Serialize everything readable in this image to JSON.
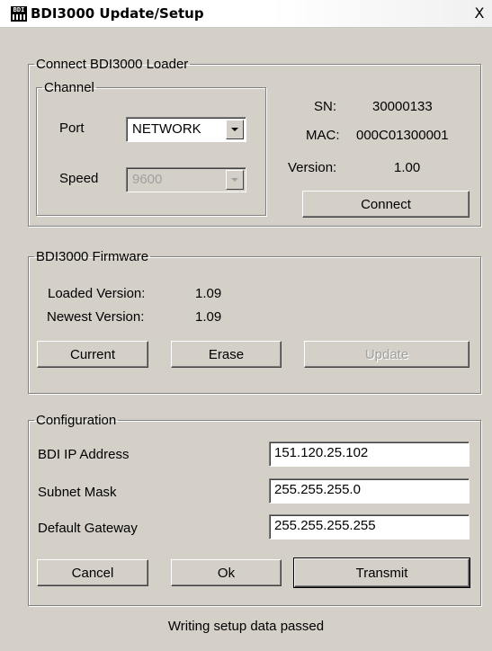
{
  "window": {
    "title": "BDI3000 Update/Setup",
    "icon_text": "BDI",
    "close_glyph": "X"
  },
  "loader": {
    "legend": "Connect BDI3000 Loader",
    "channel_legend": "Channel",
    "port_label": "Port",
    "port_value": "NETWORK",
    "speed_label": "Speed",
    "speed_value": "9600",
    "sn_label": "SN:",
    "sn_value": "30000133",
    "mac_label": "MAC:",
    "mac_value": "000C01300001",
    "version_label": "Version:",
    "version_value": "1.00",
    "connect_label": "Connect"
  },
  "firmware": {
    "legend": "BDI3000 Firmware",
    "loaded_label": "Loaded Version:",
    "loaded_value": "1.09",
    "newest_label": "Newest Version:",
    "newest_value": "1.09",
    "current_label": "Current",
    "erase_label": "Erase",
    "update_label": "Update"
  },
  "config": {
    "legend": "Configuration",
    "ip_label": "BDI IP Address",
    "ip_value": "151.120.25.102",
    "subnet_label": "Subnet Mask",
    "subnet_value": "255.255.255.0",
    "gateway_label": "Default Gateway",
    "gateway_value": "255.255.255.255",
    "cancel_label": "Cancel",
    "ok_label": "Ok",
    "transmit_label": "Transmit"
  },
  "status": "Writing setup data passed",
  "colors": {
    "face": "#d4d0c8",
    "disabled_text": "#a0a0a0"
  }
}
